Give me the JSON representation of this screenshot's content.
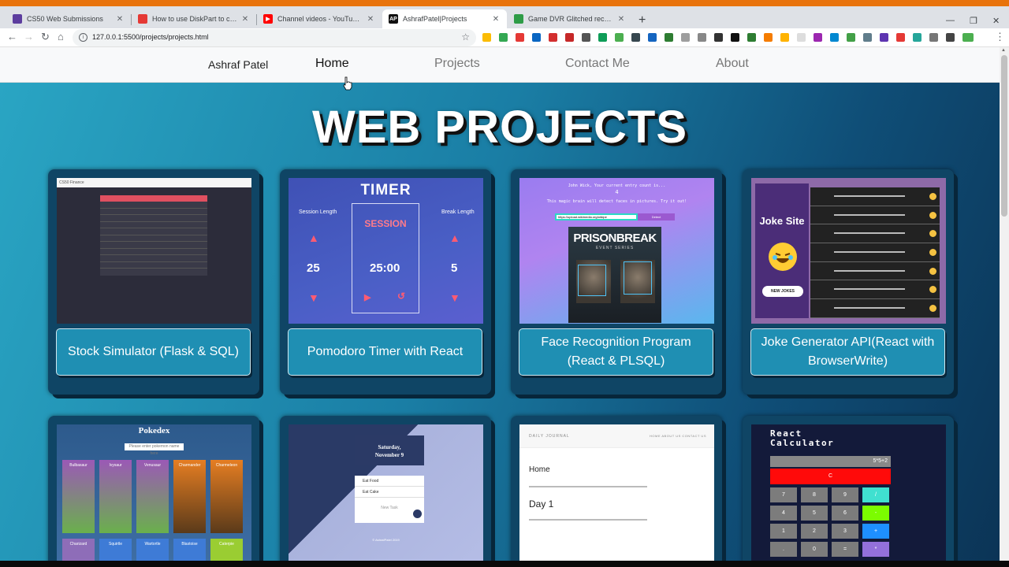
{
  "browser": {
    "tabs": [
      {
        "title": "CS50 Web Submissions",
        "favicon_color": "#5c3d9e"
      },
      {
        "title": "How to use DiskPart to clean and...",
        "favicon_color": "#e53935"
      },
      {
        "title": "Channel videos - YouTube Studio",
        "favicon_color": "#ff0000"
      },
      {
        "title": "AshrafPatel|Projects",
        "favicon_color": "#111111",
        "favicon_text": "AP"
      },
      {
        "title": "Game DVR Glitched recording - M...",
        "favicon_color": "#2e9c47"
      }
    ],
    "url": "127.0.0.1:5500/projects/projects.html"
  },
  "site": {
    "brand": "Ashraf Patel",
    "nav": [
      "Home",
      "Projects",
      "Contact Me",
      "About"
    ],
    "title": "WEB PROJECTS"
  },
  "projects": [
    {
      "label": "Stock Simulator (Flask & SQL)",
      "thumb": "stock"
    },
    {
      "label": "Pomodoro Timer with React",
      "thumb": "timer"
    },
    {
      "label": "Face Recognition Program (React & PLSQL)",
      "thumb": "face"
    },
    {
      "label": "Joke Generator API(React with BrowserWrite)",
      "thumb": "joke"
    },
    {
      "thumb": "pokedex"
    },
    {
      "thumb": "calendar"
    },
    {
      "thumb": "journal"
    },
    {
      "thumb": "calculator"
    }
  ],
  "thumbs": {
    "stock": {
      "brand": "CS50 Finance"
    },
    "timer": {
      "title": "TIMER",
      "session_length": "Session Length",
      "break_length": "Break Length",
      "session": "SESSION",
      "session_value": "25",
      "timer": "25:00",
      "break_value": "5"
    },
    "face": {
      "line1": "John Wick, Your current entry count is...",
      "count": "4",
      "line2": "This magic brain will detect faces in pictures. Try it out!",
      "input": "https://upload.wikimedia.org/wikipe",
      "button": "Detect",
      "poster_title": "PRISONBREAK",
      "poster_sub": "EVENT SERIES"
    },
    "joke": {
      "title": "Joke Site",
      "button": "NEW JOKES"
    },
    "pokedex": {
      "title": "Pokedex",
      "placeholder": "Please enter pokemon name here",
      "row1": [
        "Bulbasaur",
        "Ivysaur",
        "Venusaur",
        "Charmander",
        "Charmeleon"
      ],
      "row2": [
        "Charizard",
        "Squirtle",
        "Wartortle",
        "Blastoise",
        "Caterpie"
      ]
    },
    "calendar": {
      "day": "Saturday,",
      "date": "November 9",
      "items": [
        "Eat Food",
        "Eat Cake"
      ],
      "new_task": "New Task",
      "footer": "© AshrafPatel 2019"
    },
    "journal": {
      "brand": "DAILY JOURNAL",
      "links": "HOME   ABOUT US   CONTACT US",
      "heading1": "Home",
      "heading2": "Day 1"
    },
    "calculator": {
      "title_line1": "React",
      "title_line2": "Calculator",
      "display": "5*5+2",
      "clear": "C",
      "keys": [
        "7",
        "8",
        "9",
        "/",
        "4",
        "5",
        "6",
        "-",
        "1",
        "2",
        "3",
        "+",
        ".",
        "0",
        "=",
        "*"
      ]
    }
  }
}
